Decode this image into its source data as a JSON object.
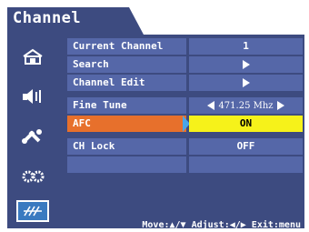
{
  "title": "Channel",
  "sidebar": {
    "icons": [
      "picture-icon",
      "sound-icon",
      "setup-icon",
      "settings-icon",
      "channel-icon"
    ],
    "active_index": 4
  },
  "menu": {
    "rows": [
      {
        "label": "Current Channel",
        "value": "1",
        "control": "text"
      },
      {
        "label": "Search",
        "value": "",
        "control": "submenu-arrow"
      },
      {
        "label": "Channel Edit",
        "value": "",
        "control": "submenu-arrow"
      },
      {
        "label": "Fine Tune",
        "value": "471.25 Mhz",
        "control": "adjust"
      },
      {
        "label": "AFC",
        "value": "ON",
        "control": "text",
        "selected": true
      },
      {
        "label": "CH Lock",
        "value": "OFF",
        "control": "text"
      },
      {
        "label": "",
        "value": "",
        "control": "empty"
      }
    ]
  },
  "footer": {
    "hint": "Move:▲/▼ Adjust:◀/▶ Exit:menu"
  },
  "colors": {
    "frame": "#3d4b80",
    "row": "#5567a8",
    "selected_label": "#e7702c",
    "selected_value": "#f6f21a"
  }
}
